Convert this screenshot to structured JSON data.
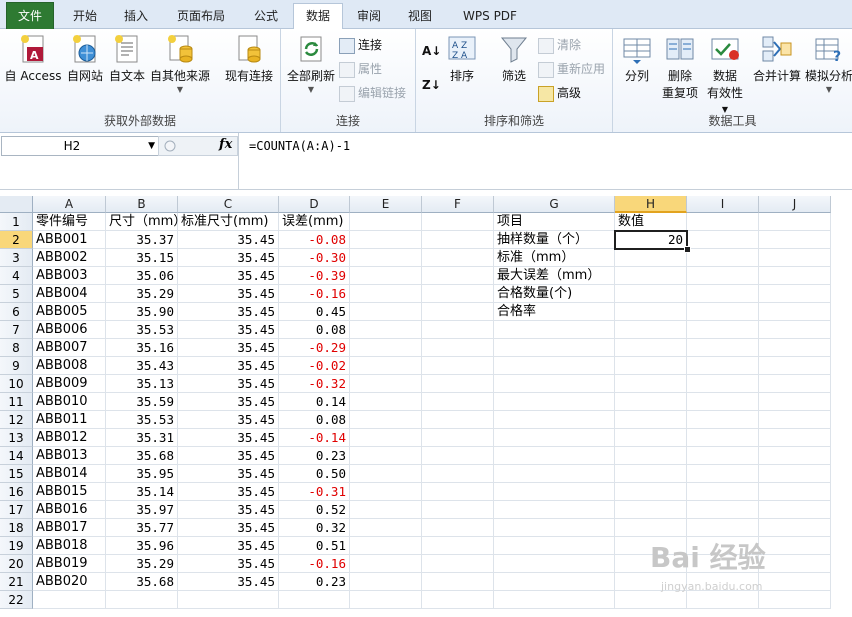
{
  "tabs": [
    "文件",
    "开始",
    "插入",
    "页面布局",
    "公式",
    "数据",
    "审阅",
    "视图",
    "WPS PDF"
  ],
  "ribbon": {
    "get_external": {
      "buttons": [
        "自 Access",
        "自网站",
        "自文本",
        "自其他来源",
        "现有连接"
      ],
      "label": "获取外部数据"
    },
    "connections": {
      "refresh": "全部刷新",
      "items": [
        "连接",
        "属性",
        "编辑链接"
      ],
      "label": "连接"
    },
    "sort_filter": {
      "sort": "排序",
      "filter": "筛选",
      "items": [
        "清除",
        "重新应用",
        "高级"
      ],
      "label": "排序和筛选"
    },
    "data_tools": {
      "split": "分列",
      "remove_dup": [
        "删除",
        "重复项"
      ],
      "validation": [
        "数据",
        "有效性"
      ],
      "merge": "合并计算",
      "whatif": "模拟分析",
      "label": "数据工具"
    }
  },
  "formula_bar": {
    "name_box": "H2",
    "fx": "fx",
    "formula": "=COUNTA(A:A)-1"
  },
  "sheet": {
    "columns": [
      "A",
      "B",
      "C",
      "D",
      "E",
      "F",
      "G",
      "H",
      "I",
      "J"
    ],
    "selected_column": "H",
    "selected_row": 2,
    "header": [
      "零件编号",
      "尺寸（mm）",
      "标准尺寸(mm)",
      "误差(mm)"
    ],
    "rows": [
      [
        "ABB001",
        "35.37",
        "35.45",
        "-0.08"
      ],
      [
        "ABB002",
        "35.15",
        "35.45",
        "-0.30"
      ],
      [
        "ABB003",
        "35.06",
        "35.45",
        "-0.39"
      ],
      [
        "ABB004",
        "35.29",
        "35.45",
        "-0.16"
      ],
      [
        "ABB005",
        "35.90",
        "35.45",
        "0.45"
      ],
      [
        "ABB006",
        "35.53",
        "35.45",
        "0.08"
      ],
      [
        "ABB007",
        "35.16",
        "35.45",
        "-0.29"
      ],
      [
        "ABB008",
        "35.43",
        "35.45",
        "-0.02"
      ],
      [
        "ABB009",
        "35.13",
        "35.45",
        "-0.32"
      ],
      [
        "ABB010",
        "35.59",
        "35.45",
        "0.14"
      ],
      [
        "ABB011",
        "35.53",
        "35.45",
        "0.08"
      ],
      [
        "ABB012",
        "35.31",
        "35.45",
        "-0.14"
      ],
      [
        "ABB013",
        "35.68",
        "35.45",
        "0.23"
      ],
      [
        "ABB014",
        "35.95",
        "35.45",
        "0.50"
      ],
      [
        "ABB015",
        "35.14",
        "35.45",
        "-0.31"
      ],
      [
        "ABB016",
        "35.97",
        "35.45",
        "0.52"
      ],
      [
        "ABB017",
        "35.77",
        "35.45",
        "0.32"
      ],
      [
        "ABB018",
        "35.96",
        "35.45",
        "0.51"
      ],
      [
        "ABB019",
        "35.29",
        "35.45",
        "-0.16"
      ],
      [
        "ABB020",
        "35.68",
        "35.45",
        "0.23"
      ]
    ],
    "summary_header": [
      "项目",
      "数值"
    ],
    "summary_items": [
      "抽样数量（个）",
      "标准（mm）",
      "最大误差（mm）",
      "合格数量(个)",
      "合格率"
    ],
    "summary_values": [
      "20",
      "",
      "",
      "",
      ""
    ],
    "row_count": 22
  },
  "watermark": {
    "main": "Bai 经验",
    "sub": "jingyan.baidu.com"
  },
  "colors": {
    "negative": "#e00000",
    "file_tab": "#2e7a32",
    "selection": "#f9d77a"
  }
}
